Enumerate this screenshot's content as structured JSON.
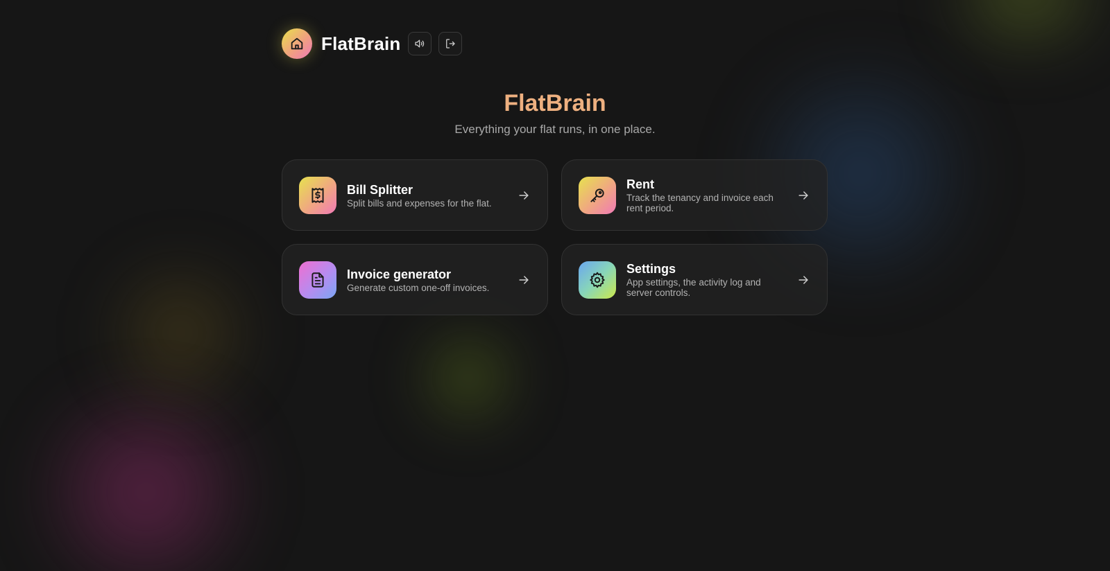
{
  "header": {
    "brand": "FlatBrain",
    "logo_icon": "home-icon",
    "buttons": [
      {
        "icon": "speaker-icon"
      },
      {
        "icon": "logout-icon"
      }
    ]
  },
  "hero": {
    "title": "FlatBrain",
    "subtitle": "Everything your flat runs, in one place."
  },
  "cards": [
    {
      "title": "Bill Splitter",
      "description": "Split bills and expenses for the flat.",
      "icon": "receipt-icon"
    },
    {
      "title": "Rent",
      "description": "Track the tenancy and invoice each rent period.",
      "icon": "key-icon"
    },
    {
      "title": "Invoice generator",
      "description": "Generate custom one-off invoices.",
      "icon": "document-icon"
    },
    {
      "title": "Settings",
      "description": "App settings, the activity log and server controls.",
      "icon": "gear-icon"
    }
  ],
  "colors": {
    "background": "#161616",
    "hero_title": "#eeb080",
    "card_border": "#323232"
  }
}
